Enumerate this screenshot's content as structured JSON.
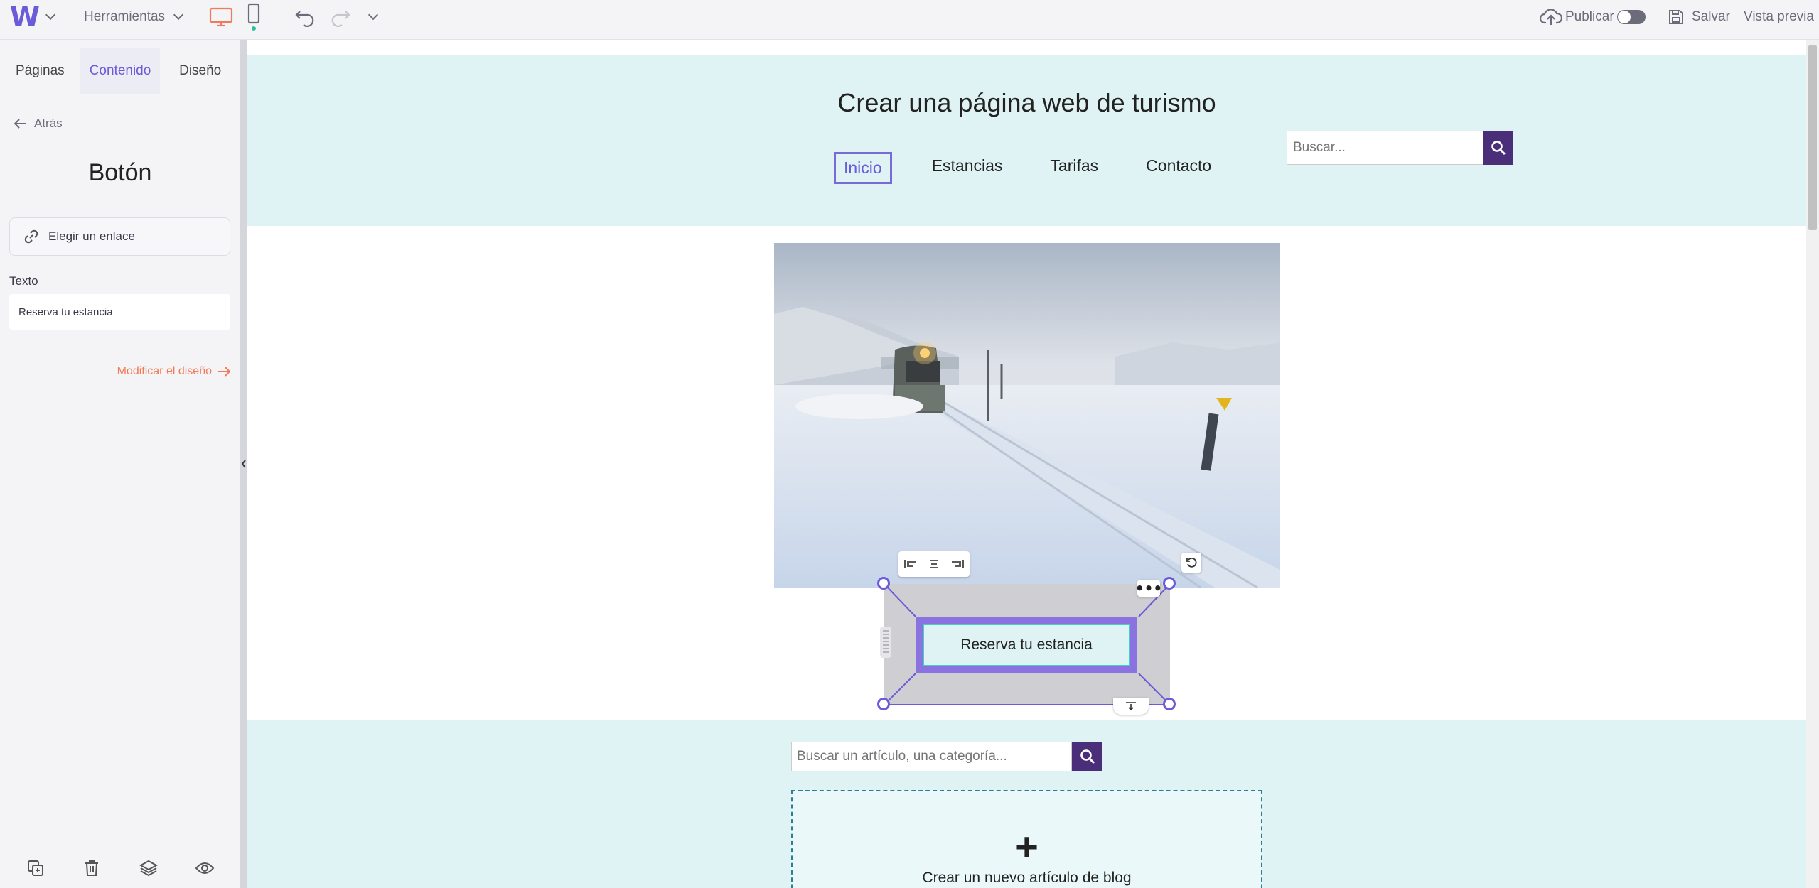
{
  "topbar": {
    "logo": "W",
    "tools_label": "Herramientas",
    "publish_label": "Publicar",
    "save_label": "Salvar",
    "preview_label": "Vista previa",
    "accent_color": "#6a5bd8",
    "device_active_color": "#f07a5a"
  },
  "sidebar": {
    "tabs": [
      {
        "label": "Páginas"
      },
      {
        "label": "Contenido"
      },
      {
        "label": "Diseño"
      }
    ],
    "back_label": "Atrás",
    "title": "Botón",
    "link_button_label": "Elegir un enlace",
    "text_label": "Texto",
    "text_value": "Reserva tu estancia",
    "modify_link": "Modificar el diseño"
  },
  "site": {
    "title": "Crear una página web de turismo",
    "nav": [
      {
        "label": "Inicio"
      },
      {
        "label": "Estancias"
      },
      {
        "label": "Tarifas"
      },
      {
        "label": "Contacto"
      }
    ],
    "search_placeholder": "Buscar...",
    "cta_label": "Reserva tu estancia",
    "blog_search_placeholder": "Buscar un artículo, una categoría...",
    "new_post_label": "Crear un nuevo artículo de blog"
  }
}
